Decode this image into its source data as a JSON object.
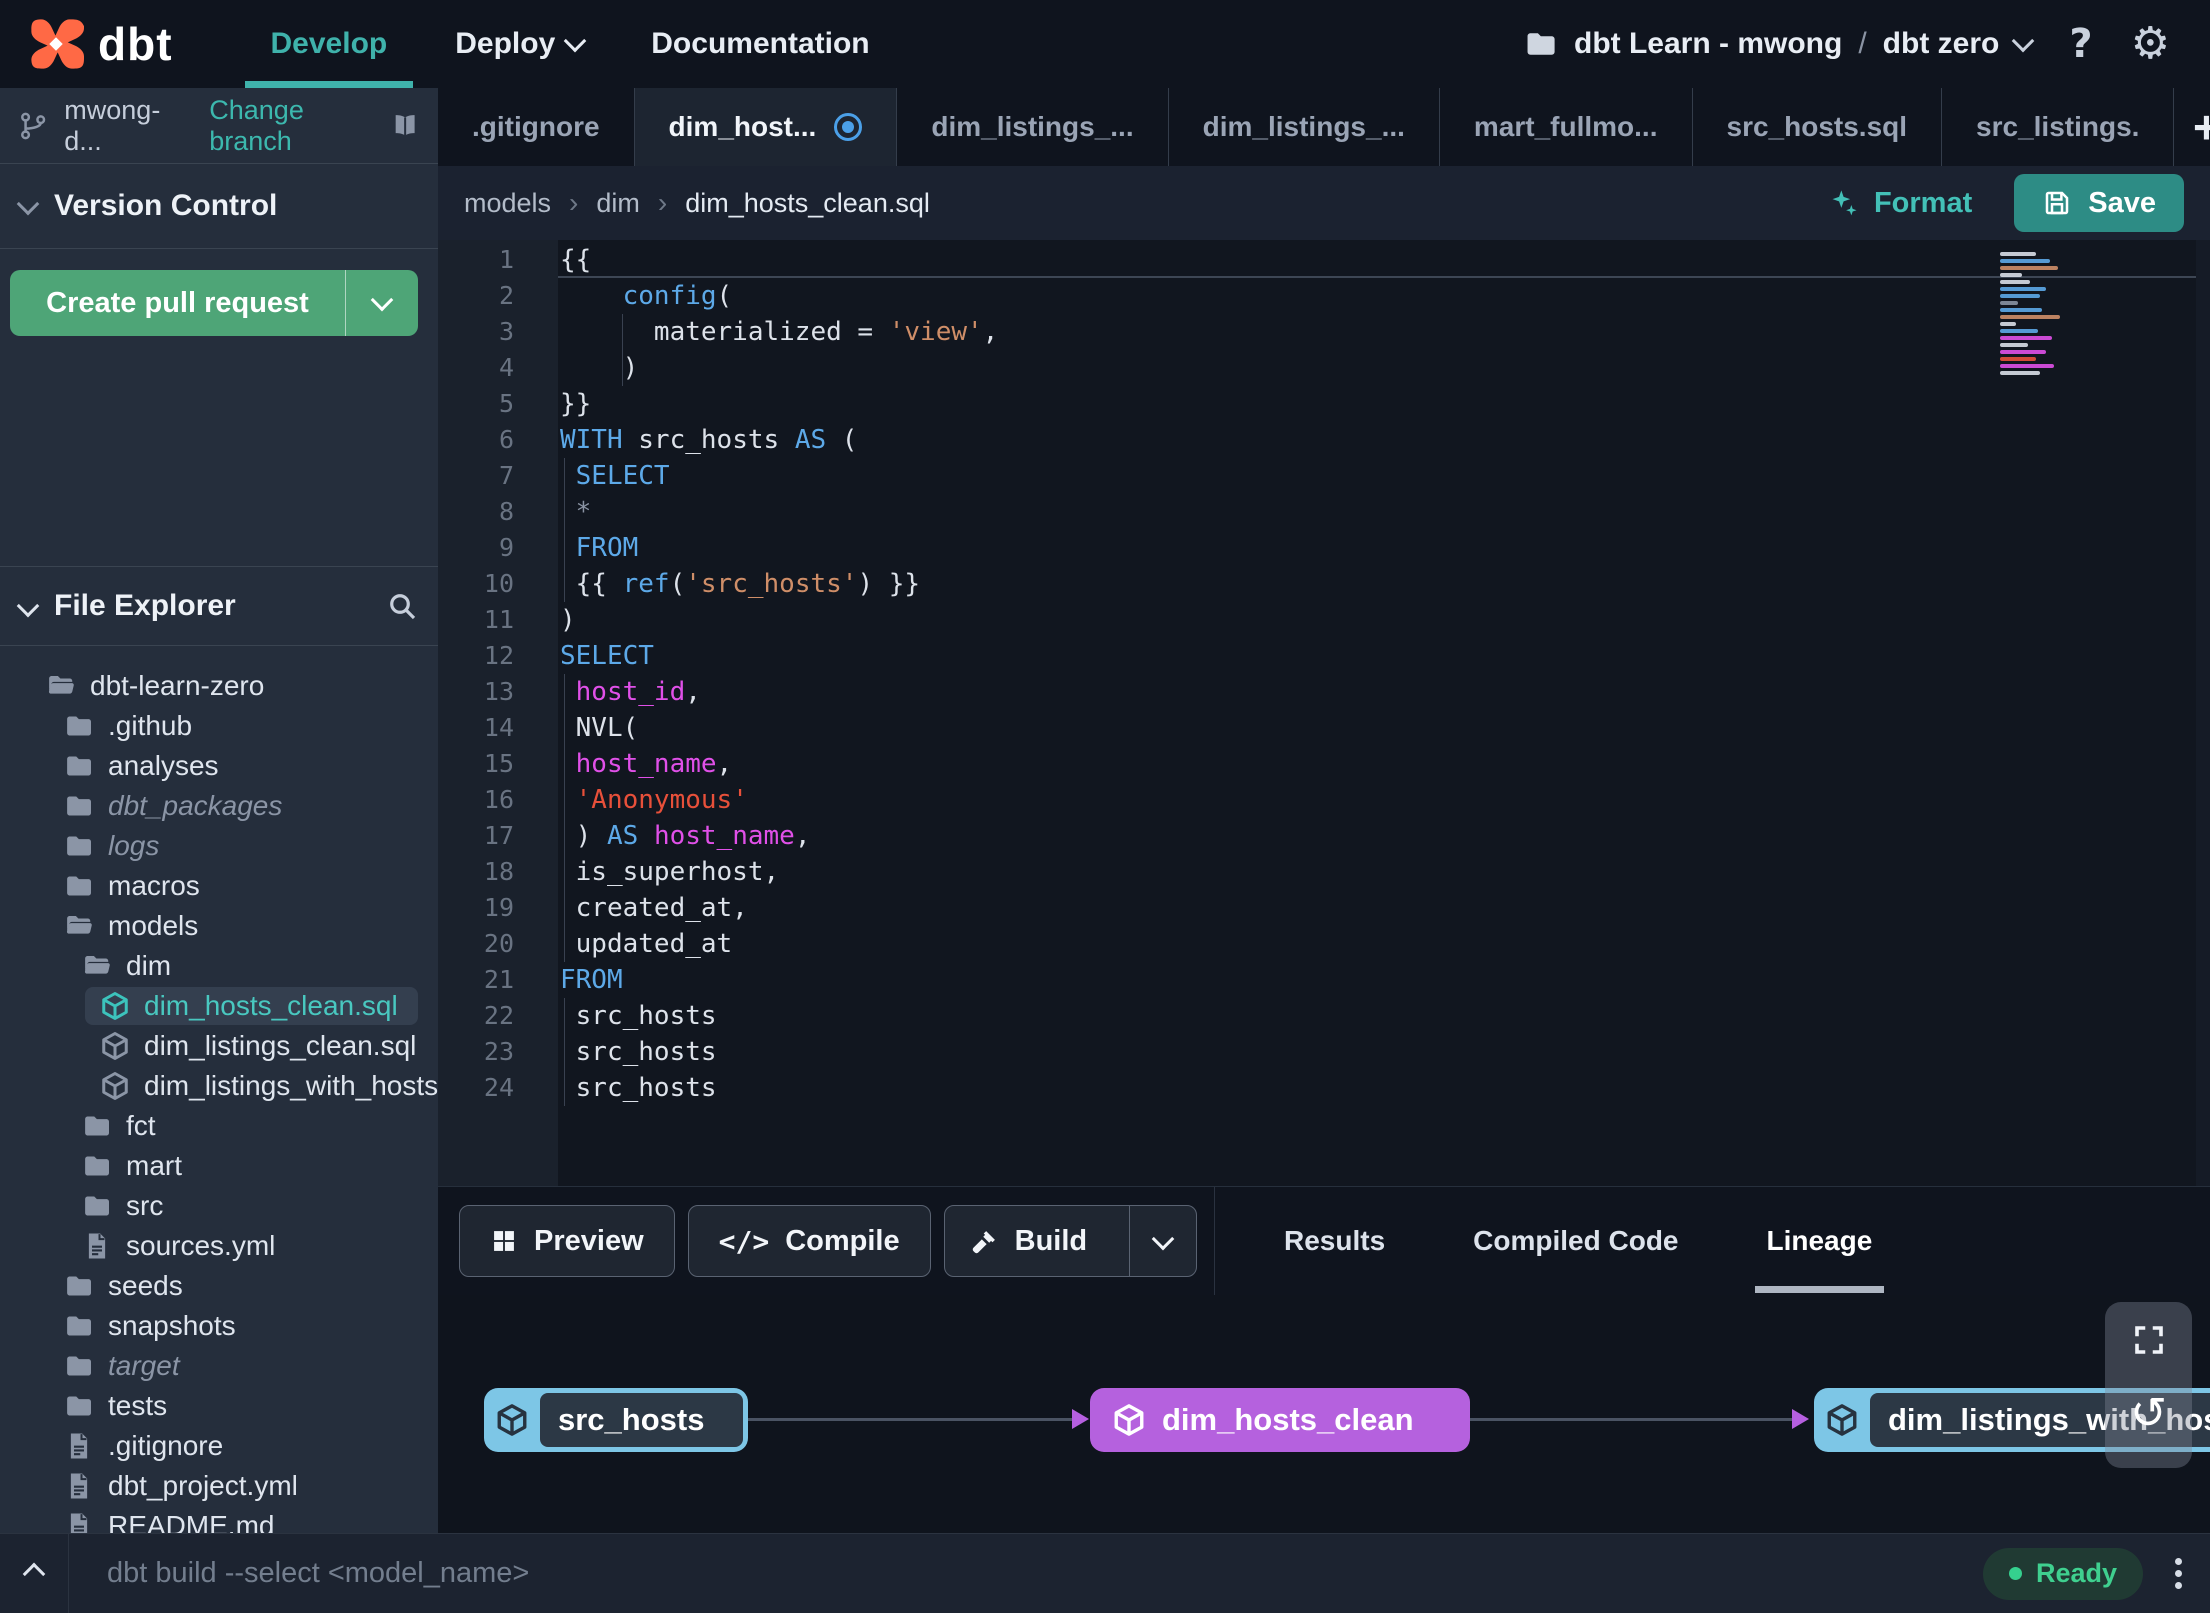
{
  "nav": {
    "logo_text": "dbt",
    "develop": "Develop",
    "deploy": "Deploy",
    "documentation": "Documentation",
    "project": "dbt Learn - mwong",
    "separator": "/",
    "env": "dbt zero",
    "help": "?"
  },
  "icons": {
    "gear": "⚙",
    "refresh": "↺",
    "plus": "+",
    "code": "</>"
  },
  "sidebar": {
    "branch": {
      "name": "mwong-d...",
      "change": "Change branch"
    },
    "version_control": {
      "title": "Version Control",
      "create_pr": "Create pull request"
    },
    "file_explorer": {
      "title": "File Explorer"
    },
    "tree": [
      {
        "depth": 1,
        "icon": "folder-open",
        "label": "dbt-learn-zero"
      },
      {
        "depth": 2,
        "icon": "folder",
        "label": ".github"
      },
      {
        "depth": 2,
        "icon": "folder",
        "label": "analyses"
      },
      {
        "depth": 2,
        "icon": "folder",
        "label": "dbt_packages",
        "italic": true
      },
      {
        "depth": 2,
        "icon": "folder",
        "label": "logs",
        "italic": true
      },
      {
        "depth": 2,
        "icon": "folder",
        "label": "macros"
      },
      {
        "depth": 2,
        "icon": "folder-open",
        "label": "models"
      },
      {
        "depth": 3,
        "icon": "folder-open",
        "label": "dim"
      },
      {
        "depth": 4,
        "icon": "cube",
        "label": "dim_hosts_clean.sql",
        "selected": true,
        "dirty": true
      },
      {
        "depth": 4,
        "icon": "cube",
        "label": "dim_listings_clean.sql"
      },
      {
        "depth": 4,
        "icon": "cube",
        "label": "dim_listings_with_hosts..."
      },
      {
        "depth": 3,
        "icon": "folder",
        "label": "fct"
      },
      {
        "depth": 3,
        "icon": "folder",
        "label": "mart"
      },
      {
        "depth": 3,
        "icon": "folder",
        "label": "src"
      },
      {
        "depth": 3,
        "icon": "file",
        "label": "sources.yml"
      },
      {
        "depth": 2,
        "icon": "folder",
        "label": "seeds"
      },
      {
        "depth": 2,
        "icon": "folder",
        "label": "snapshots"
      },
      {
        "depth": 2,
        "icon": "folder",
        "label": "target",
        "italic": true
      },
      {
        "depth": 2,
        "icon": "folder",
        "label": "tests"
      },
      {
        "depth": 2,
        "icon": "file",
        "label": ".gitignore"
      },
      {
        "depth": 2,
        "icon": "file",
        "label": "dbt_project.yml"
      },
      {
        "depth": 2,
        "icon": "file",
        "label": "README.md"
      }
    ]
  },
  "tabs": {
    "items": [
      {
        "label": ".gitignore"
      },
      {
        "label": "dim_host...",
        "active": true,
        "dirty": true
      },
      {
        "label": "dim_listings_..."
      },
      {
        "label": "dim_listings_..."
      },
      {
        "label": "mart_fullmo..."
      },
      {
        "label": "src_hosts.sql"
      },
      {
        "label": "src_listings."
      }
    ]
  },
  "editor": {
    "breadcrumb": [
      "models",
      "dim",
      "dim_hosts_clean.sql"
    ],
    "sep": "›",
    "format": "Format",
    "save": "Save",
    "lines": [
      {
        "n": "1",
        "active": true,
        "tokens": [
          [
            "{{",
            "p"
          ]
        ]
      },
      {
        "n": "2",
        "tokens": [
          [
            "    ",
            "p"
          ],
          [
            "config",
            "k"
          ],
          [
            "(",
            "p"
          ]
        ]
      },
      {
        "n": "3",
        "guides": [
          64
        ],
        "tokens": [
          [
            "      materialized = ",
            "p"
          ],
          [
            "'view'",
            "s"
          ],
          [
            ",",
            "p"
          ]
        ]
      },
      {
        "n": "4",
        "guides": [
          64
        ],
        "tokens": [
          [
            "    )",
            "p"
          ]
        ]
      },
      {
        "n": "5",
        "tokens": [
          [
            "}}",
            "p"
          ]
        ]
      },
      {
        "n": "6",
        "tokens": [
          [
            "WITH",
            "k"
          ],
          [
            " src_hosts ",
            "p"
          ],
          [
            "AS",
            "k"
          ],
          [
            " (",
            "p"
          ]
        ]
      },
      {
        "n": "7",
        "guides": [
          6
        ],
        "tokens": [
          [
            " ",
            "p"
          ],
          [
            "SELECT",
            "k"
          ]
        ]
      },
      {
        "n": "8",
        "guides": [
          6
        ],
        "tokens": [
          [
            " *",
            "g"
          ]
        ]
      },
      {
        "n": "9",
        "guides": [
          6
        ],
        "tokens": [
          [
            " ",
            "p"
          ],
          [
            "FROM",
            "k"
          ]
        ]
      },
      {
        "n": "10",
        "guides": [
          6
        ],
        "tokens": [
          [
            " {{ ",
            "p"
          ],
          [
            "ref",
            "k"
          ],
          [
            "(",
            "p"
          ],
          [
            "'src_hosts'",
            "s"
          ],
          [
            ") }}",
            "p"
          ]
        ]
      },
      {
        "n": "11",
        "tokens": [
          [
            ")",
            "p"
          ]
        ]
      },
      {
        "n": "12",
        "tokens": [
          [
            "SELECT",
            "k"
          ]
        ]
      },
      {
        "n": "13",
        "guides": [
          6
        ],
        "tokens": [
          [
            " ",
            "p"
          ],
          [
            "host_id",
            "i"
          ],
          [
            ",",
            "p"
          ]
        ]
      },
      {
        "n": "14",
        "guides": [
          6
        ],
        "tokens": [
          [
            " NVL(",
            "p"
          ]
        ]
      },
      {
        "n": "15",
        "guides": [
          6
        ],
        "tokens": [
          [
            " ",
            "p"
          ],
          [
            "host_name",
            "i"
          ],
          [
            ",",
            "p"
          ]
        ]
      },
      {
        "n": "16",
        "guides": [
          6
        ],
        "tokens": [
          [
            " ",
            "p"
          ],
          [
            "'Anonymous'",
            "r"
          ]
        ]
      },
      {
        "n": "17",
        "guides": [
          6
        ],
        "tokens": [
          [
            " ) ",
            "p"
          ],
          [
            "AS",
            "k"
          ],
          [
            " ",
            "p"
          ],
          [
            "host_name",
            "i"
          ],
          [
            ",",
            "p"
          ]
        ]
      },
      {
        "n": "18",
        "guides": [
          6
        ],
        "tokens": [
          [
            " is_superhost,",
            "p"
          ]
        ]
      },
      {
        "n": "19",
        "guides": [
          6
        ],
        "tokens": [
          [
            " created_at,",
            "p"
          ]
        ]
      },
      {
        "n": "20",
        "guides": [
          6
        ],
        "tokens": [
          [
            " updated_at",
            "p"
          ]
        ]
      },
      {
        "n": "21",
        "tokens": [
          [
            "FROM",
            "k"
          ]
        ]
      },
      {
        "n": "22",
        "guides": [
          6
        ],
        "tokens": [
          [
            " src_hosts",
            "p"
          ]
        ]
      },
      {
        "n": "23",
        "guides": [
          6
        ],
        "tokens": [
          [
            " src_hosts",
            "p"
          ]
        ]
      },
      {
        "n": "24",
        "guides": [
          6
        ],
        "tokens": [
          [
            " src_hosts",
            "p"
          ]
        ]
      }
    ],
    "minimap": [
      [
        36,
        "w"
      ],
      [
        50,
        "k"
      ],
      [
        58,
        "s"
      ],
      [
        22,
        "w"
      ],
      [
        30,
        "w"
      ],
      [
        46,
        "k"
      ],
      [
        40,
        "k"
      ],
      [
        18,
        "g"
      ],
      [
        42,
        "k"
      ],
      [
        60,
        "s"
      ],
      [
        16,
        "w"
      ],
      [
        38,
        "k"
      ],
      [
        52,
        "i"
      ],
      [
        28,
        "w"
      ],
      [
        46,
        "i"
      ],
      [
        36,
        "r"
      ],
      [
        54,
        "i"
      ],
      [
        40,
        "w"
      ]
    ]
  },
  "panel": {
    "preview": "Preview",
    "compile": "Compile",
    "build": "Build",
    "tabs": [
      {
        "label": "Results"
      },
      {
        "label": "Compiled Code"
      },
      {
        "label": "Lineage",
        "active": true
      }
    ]
  },
  "lineage": {
    "nodes": [
      {
        "label": "src_hosts",
        "kind": "source"
      },
      {
        "label": "dim_hosts_clean",
        "kind": "model"
      },
      {
        "label": "dim_listings_with_hosts",
        "kind": "source"
      }
    ]
  },
  "status": {
    "command": "dbt build --select <model_name>",
    "ready": "Ready"
  },
  "colors": {
    "accent_teal": "#3fb2ab",
    "green_button": "#4ea577",
    "save_button": "#2d8c85",
    "node_purple": "#b561de",
    "node_blue": "#7dc6e6",
    "ready_green": "#3fd08f",
    "code_keyword": "#5da9e8",
    "code_string": "#cf8e68",
    "code_string_red": "#e8503a",
    "code_identifier": "#e050e8"
  }
}
